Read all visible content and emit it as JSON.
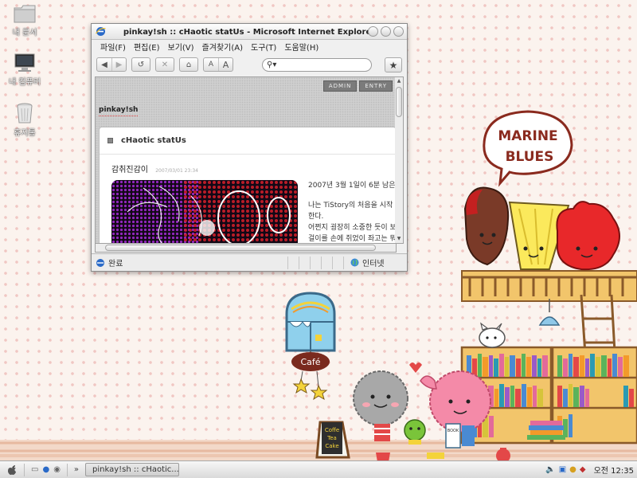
{
  "desktop": {
    "icons": [
      {
        "label": "내 문서"
      },
      {
        "label": "내 컴퓨터"
      },
      {
        "label": "휴지통"
      }
    ]
  },
  "wallpaper": {
    "sign_line1": "MARINE",
    "sign_line2": "BLUES",
    "cafe_sign": "Café",
    "board_line1": "Coffe",
    "board_line2": "Tea",
    "board_line3": "Cake",
    "book_label": "BOOK"
  },
  "window": {
    "title": "pinkay!sh :: cHaotic statUs - Microsoft Internet Explorer",
    "menu": [
      "파일(F)",
      "편집(E)",
      "보기(V)",
      "즐겨찾기(A)",
      "도구(T)",
      "도움말(H)"
    ],
    "search": {
      "value": ""
    },
    "page": {
      "admin_label": "ADMIN",
      "entry_label": "ENTRY",
      "blog_name": "pinkay!sh",
      "category": "cHaotic statUs",
      "post_title": "감취진감이",
      "post_date": "2007/03/01 23:34",
      "post_lines": [
        "2007년 3월 1일이 6분 남은 지",
        "",
        "나는 TiStory의 처음을 시작",
        "한다.",
        "어쩐지 굉장히 소중한 듯이 보",
        "걸이를 손에 쥐었이 좌고는 뭐"
      ]
    },
    "status": {
      "left": "완료",
      "zone": "인터넷"
    }
  },
  "taskbar": {
    "chevron": "»",
    "task_label": "pinkay!sh :: cHaotic...",
    "clock": "오전 12:35"
  },
  "colors": {
    "wallpaper_bg": "#fbf3ee",
    "polka": "#f0c6c2",
    "accent_red": "#d93a3a"
  }
}
